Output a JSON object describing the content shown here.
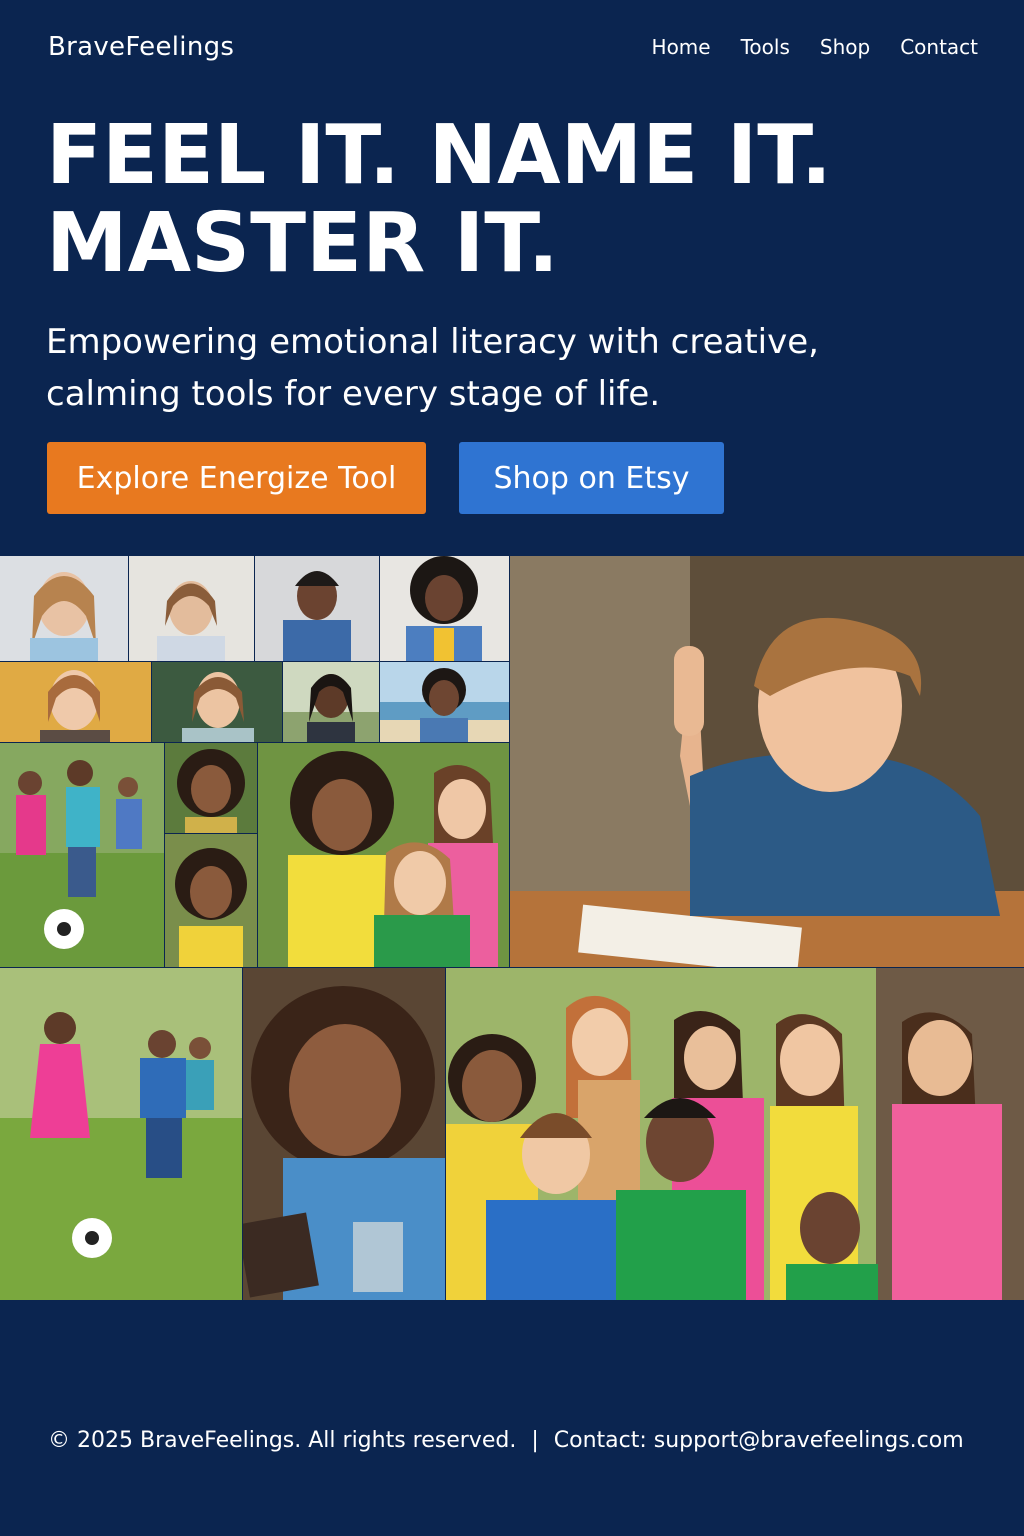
{
  "header": {
    "brand": "BraveFeelings",
    "nav": [
      "Home",
      "Tools",
      "Shop",
      "Contact"
    ]
  },
  "hero": {
    "title": "FEEL IT. NAME IT.\nMASTER IT.",
    "subtitle": "Empowering emotional literacy with creative, calming tools for every stage of life.",
    "primary_button": "Explore Energize Tool",
    "secondary_button": "Shop on Etsy"
  },
  "collage": {
    "photos": [
      "smiling-girl-portrait",
      "girl-looking-down-portrait",
      "laughing-child-denim-jacket",
      "girl-afro-denim-jacket",
      "girl-hands-on-cheeks",
      "girl-chin-on-hand",
      "child-covering-face",
      "girl-beach-portrait",
      "children-playing-soccer",
      "girl-curly-hair-smiling",
      "girl-curly-hair-yellow-shirt",
      "three-girls-park",
      "boy-raising-hand-at-desk",
      "girl-pink-dress-running",
      "girl-with-book-smiling",
      "group-of-children-park"
    ]
  },
  "colors": {
    "background": "#0b2550",
    "primary_button": "#e8791f",
    "secondary_button": "#2f74d2",
    "text": "#ffffff"
  },
  "footer": {
    "copyright": "© 2025 BraveFeelings. All rights reserved.",
    "separator": "|",
    "contact": "Contact: support@bravefeelings.com"
  }
}
